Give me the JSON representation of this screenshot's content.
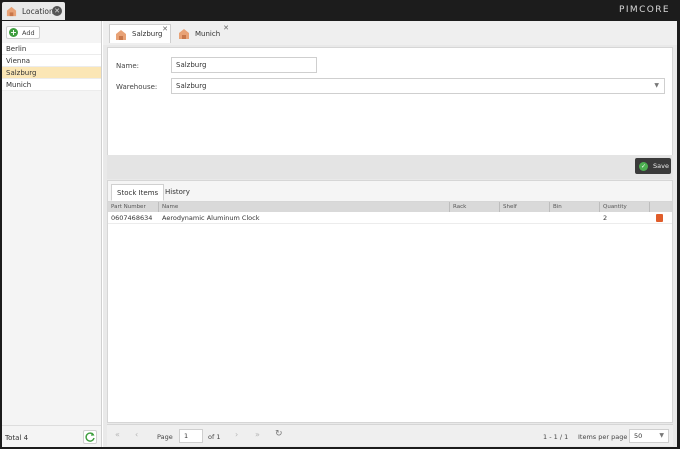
{
  "app": {
    "tab_label": "Location",
    "brand": "PIMCORE"
  },
  "sidebar": {
    "add_label": "Add",
    "items": [
      "Berlin",
      "Vienna",
      "Salzburg",
      "Munich"
    ],
    "total": "Total 4"
  },
  "tabs": [
    {
      "label": "Salzburg"
    },
    {
      "label": "Munich"
    }
  ],
  "form": {
    "name_label": "Name:",
    "name_value": "Salzburg",
    "warehouse_label": "Warehouse:",
    "warehouse_value": "Salzburg"
  },
  "toolbar": {
    "save_label": "Save"
  },
  "subtabs": [
    "Stock Items",
    "History"
  ],
  "grid": {
    "columns": [
      "Part Number",
      "Name",
      "Rack",
      "Shelf",
      "Bin",
      "Quantity"
    ],
    "rows": [
      {
        "part_number": "0607468634",
        "name": "Aerodynamic Aluminum Clock",
        "rack": "",
        "shelf": "",
        "bin": "",
        "quantity": "2"
      }
    ]
  },
  "pager": {
    "page_label": "Page",
    "page_value": "1",
    "of_label": "of 1",
    "range": "1 - 1 / 1",
    "items_per_page_label": "Items per page",
    "items_per_page": "50"
  },
  "colors": {
    "selected_row": "#fbe6b5",
    "accent_green": "#3f9e3f",
    "dark_bar": "#1c1c1c"
  }
}
